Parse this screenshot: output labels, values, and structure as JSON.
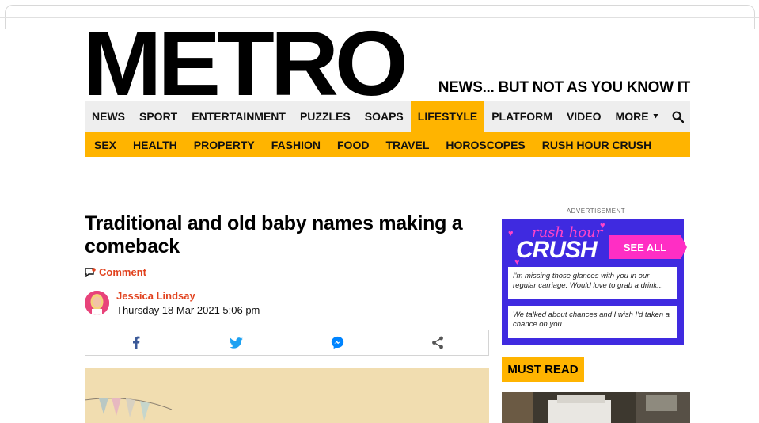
{
  "brand": {
    "logo": "METRO",
    "tagline": "NEWS... BUT NOT AS YOU KNOW IT",
    "accent": "#ffb400",
    "link_color": "#e1421e"
  },
  "nav": {
    "items": [
      {
        "label": "NEWS"
      },
      {
        "label": "SPORT"
      },
      {
        "label": "ENTERTAINMENT"
      },
      {
        "label": "PUZZLES"
      },
      {
        "label": "SOAPS"
      },
      {
        "label": "LIFESTYLE",
        "active": true
      },
      {
        "label": "PLATFORM"
      },
      {
        "label": "VIDEO"
      },
      {
        "label": "MORE"
      }
    ],
    "search_icon": "search-icon"
  },
  "subnav": {
    "items": [
      {
        "label": "SEX"
      },
      {
        "label": "HEALTH"
      },
      {
        "label": "PROPERTY"
      },
      {
        "label": "FASHION"
      },
      {
        "label": "FOOD"
      },
      {
        "label": "TRAVEL"
      },
      {
        "label": "HOROSCOPES"
      },
      {
        "label": "RUSH HOUR CRUSH"
      }
    ]
  },
  "article": {
    "headline": "Traditional and old baby names making a comeback",
    "comment_label": "Comment",
    "author_name": "Jessica Lindsay",
    "date": "Thursday 18 Mar 2021 5:06 pm",
    "share": [
      "facebook-icon",
      "twitter-icon",
      "messenger-icon",
      "share-icon"
    ]
  },
  "sidebar": {
    "ad_label": "ADVERTISEMENT",
    "rhc": {
      "script": "rush hour",
      "title": "CRUSH",
      "see_all": "SEE ALL",
      "messages": [
        "I'm missing those glances with you in our regular carriage. Would love to grab a drink...",
        "We talked about chances and I wish I'd taken a chance on you."
      ]
    },
    "must_read": "MUST READ"
  }
}
